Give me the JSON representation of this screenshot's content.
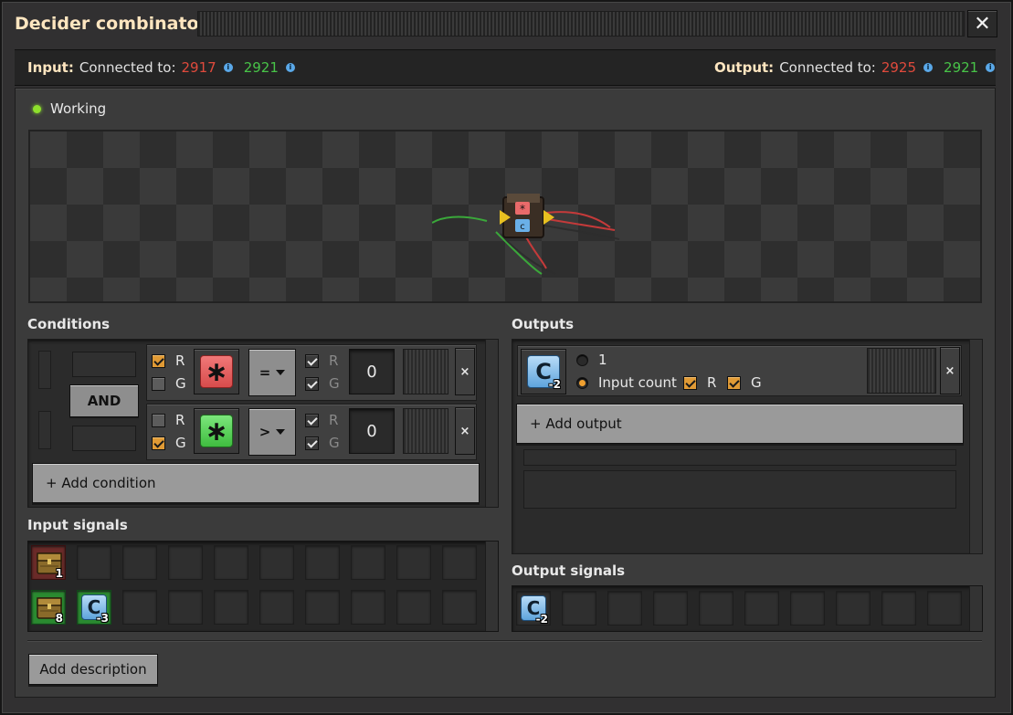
{
  "window": {
    "title": "Decider combinator",
    "close_label": "✕"
  },
  "connections": {
    "input_label": "Input:",
    "input_text": "Connected to:",
    "input_red": "2917",
    "input_green": "2921",
    "output_label": "Output:",
    "output_text": "Connected to:",
    "output_red": "2925",
    "output_green": "2921",
    "info_glyph": "i"
  },
  "status": {
    "text": "Working",
    "color": "#8ee02c"
  },
  "conditions": {
    "heading": "Conditions",
    "and_label": "AND",
    "rows": [
      {
        "left_r_label": "R",
        "left_r_checked": true,
        "left_g_label": "G",
        "left_g_checked": false,
        "signal_glyph": "∗",
        "signal_color": "red",
        "comparator": "=",
        "right_r_label": "R",
        "right_r_checked": true,
        "right_g_label": "G",
        "right_g_checked": true,
        "constant": "0",
        "remove_label": "×"
      },
      {
        "left_r_label": "R",
        "left_r_checked": false,
        "left_g_label": "G",
        "left_g_checked": true,
        "signal_glyph": "∗",
        "signal_color": "green",
        "comparator": ">",
        "right_r_label": "R",
        "right_r_checked": true,
        "right_g_label": "G",
        "right_g_checked": true,
        "constant": "0",
        "remove_label": "×"
      }
    ],
    "add_label": "+ Add condition"
  },
  "outputs": {
    "heading": "Outputs",
    "row": {
      "signal_letter": "C",
      "signal_badge": "-2",
      "option_one_label": "1",
      "option_one_selected": false,
      "option_input_label": "Input count",
      "option_input_selected": true,
      "r_label": "R",
      "r_checked": true,
      "g_label": "G",
      "g_checked": true,
      "remove_label": "×"
    },
    "add_label": "+ Add output"
  },
  "input_signals": {
    "heading": "Input signals",
    "red_wire": [
      {
        "icon": "wooden-chest-icon",
        "count": "1"
      }
    ],
    "green_wire": [
      {
        "icon": "wooden-chest-icon",
        "count": "8"
      },
      {
        "icon": "signal-c-icon",
        "letter": "C",
        "count": "-3"
      }
    ]
  },
  "output_signals": {
    "heading": "Output signals",
    "items": [
      {
        "icon": "signal-c-icon",
        "letter": "C",
        "count": "-2"
      }
    ]
  },
  "footer": {
    "description_button": "Add description"
  },
  "colors": {
    "red_wire": "#e04a3c",
    "green_wire": "#48c448",
    "accent_orange": "#e09a35",
    "title": "#ffe6c0"
  }
}
